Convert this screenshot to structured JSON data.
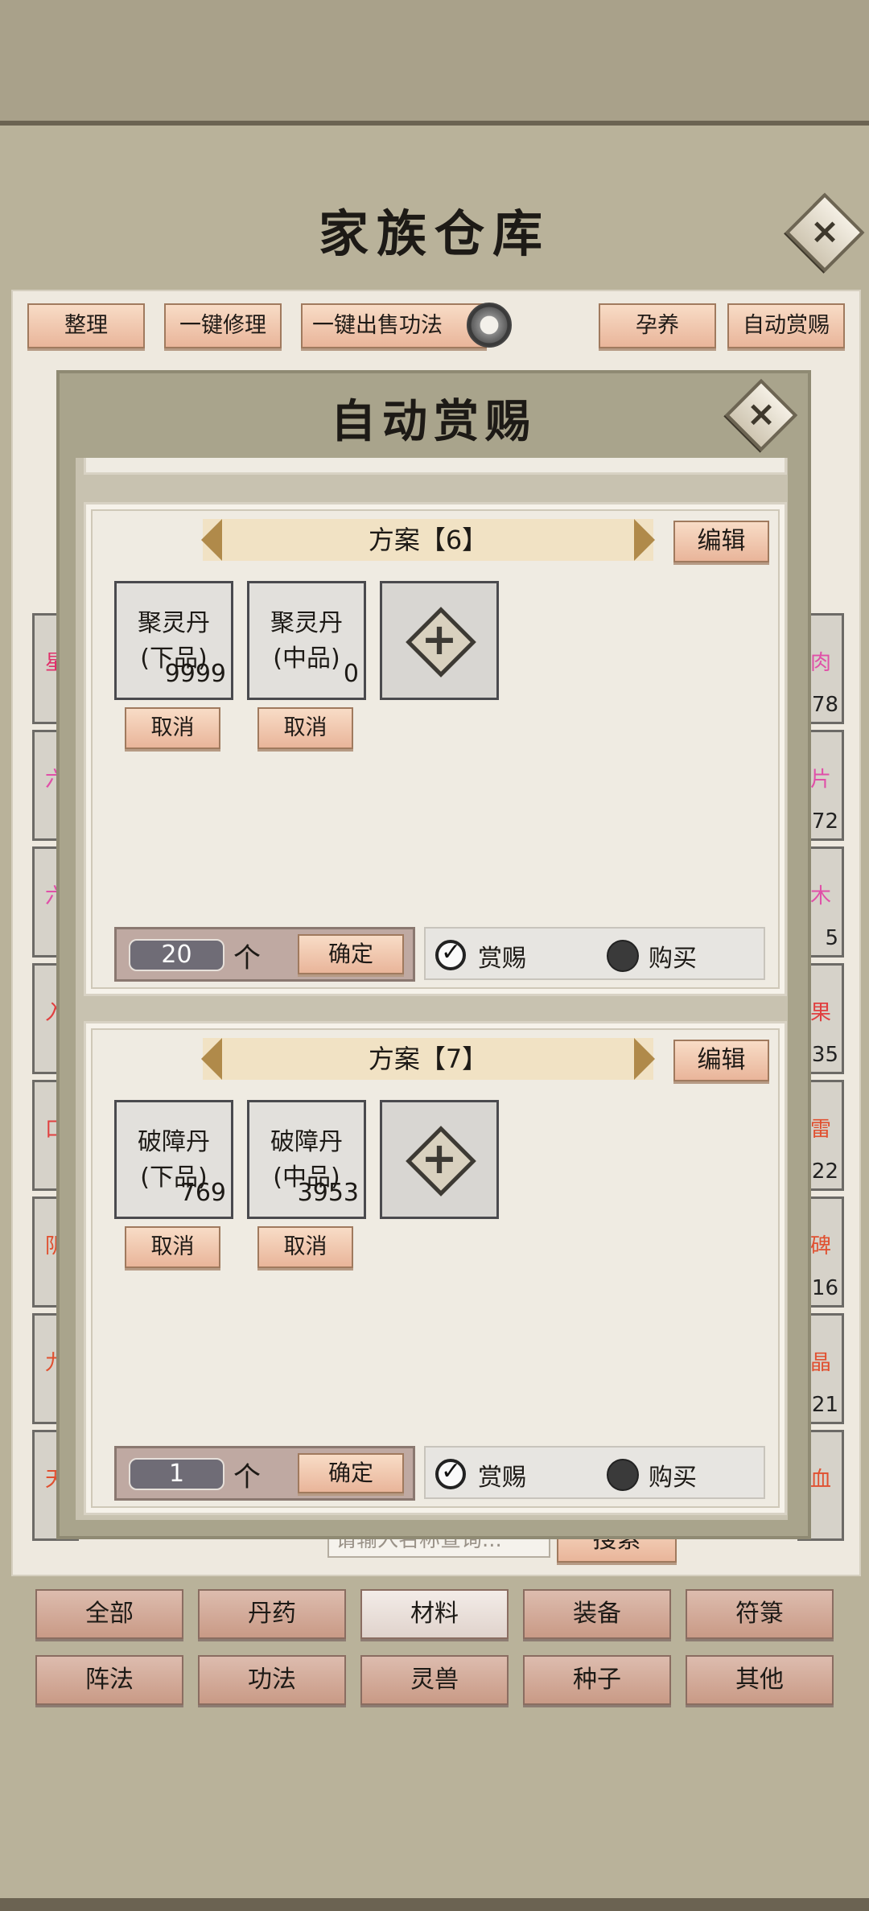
{
  "warehouse": {
    "title": "家族仓库",
    "close_glyph": "×",
    "toolbar": {
      "tidy": "整理",
      "repair_all": "一键修理",
      "sell_all": "一键出售功法",
      "nurture": "孕养",
      "auto_reward": "自动赏赐"
    },
    "left_items": [
      {
        "label": "星",
        "color": "#e0306a"
      },
      {
        "label": "六",
        "color": "#e050a8"
      },
      {
        "label": "六",
        "color": "#e050a8"
      },
      {
        "label": "入",
        "color": "#e04040"
      },
      {
        "label": "口",
        "color": "#e04040"
      },
      {
        "label": "阴",
        "color": "#e05030"
      },
      {
        "label": "九",
        "color": "#e05030"
      },
      {
        "label": "天",
        "color": "#e05030"
      }
    ],
    "right_items": [
      {
        "label": "肉",
        "count": "78",
        "color": "#e050a8"
      },
      {
        "label": "片",
        "count": "72",
        "color": "#e050a8"
      },
      {
        "label": "木",
        "count": "5",
        "color": "#e050a8"
      },
      {
        "label": "果",
        "count": "35",
        "color": "#e04040"
      },
      {
        "label": "雷",
        "count": "22",
        "color": "#e05030"
      },
      {
        "label": "碑",
        "count": "16",
        "color": "#e05030"
      },
      {
        "label": "晶",
        "count": "21",
        "color": "#e05030"
      },
      {
        "label": "血",
        "count": "",
        "color": "#e05030"
      }
    ],
    "search": {
      "placeholder": "请输入名称查询...",
      "button": "搜索"
    },
    "categories_row1": [
      "全部",
      "丹药",
      "材料",
      "装备",
      "符箓"
    ],
    "categories_row2": [
      "阵法",
      "功法",
      "灵兽",
      "种子",
      "其他"
    ],
    "active_category": "材料"
  },
  "modal": {
    "title": "自动赏赐",
    "close_glyph": "×",
    "plans": [
      {
        "name": "方案【6】",
        "edit": "编辑",
        "items": [
          {
            "name": "聚灵丹\n(下品)",
            "count": "9999",
            "cancel": "取消"
          },
          {
            "name": "聚灵丹\n(中品)",
            "count": "0",
            "cancel": "取消"
          }
        ],
        "add_glyph": "+",
        "quantity": "20",
        "unit": "个",
        "confirm": "确定",
        "mode_reward": "赏赐",
        "mode_buy": "购买",
        "selected_mode": "赏赐"
      },
      {
        "name": "方案【7】",
        "edit": "编辑",
        "items": [
          {
            "name": "破障丹\n(下品)",
            "count": "769",
            "cancel": "取消"
          },
          {
            "name": "破障丹\n(中品)",
            "count": "3953",
            "cancel": "取消"
          }
        ],
        "add_glyph": "+",
        "quantity": "1",
        "unit": "个",
        "confirm": "确定",
        "mode_reward": "赏赐",
        "mode_buy": "购买",
        "selected_mode": "赏赐"
      }
    ]
  }
}
